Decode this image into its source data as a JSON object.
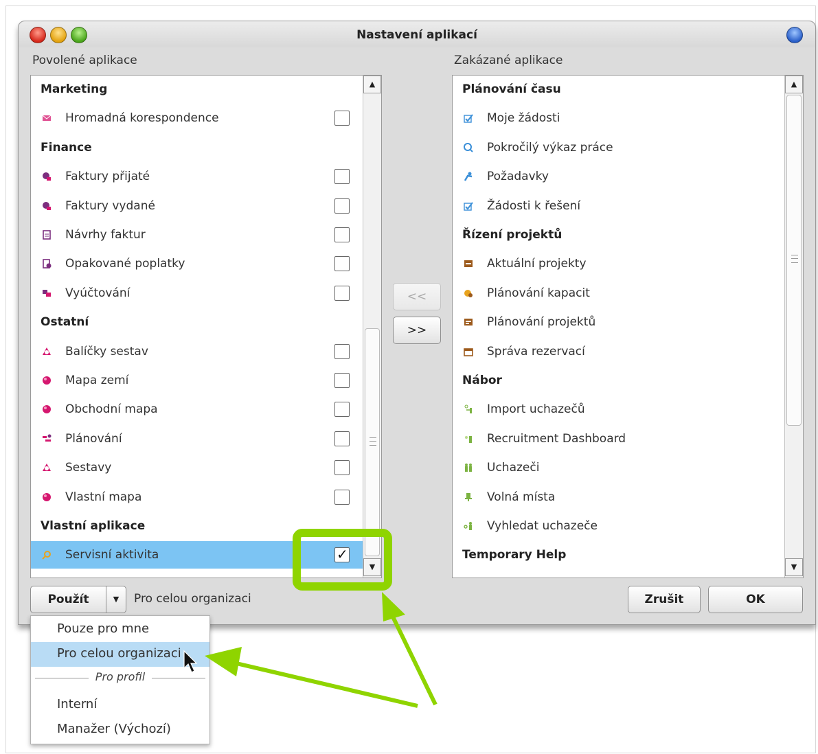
{
  "window": {
    "title": "Nastavení aplikací"
  },
  "enabled_pane": {
    "title": "Povolené aplikace",
    "groups": [
      {
        "name": "Marketing",
        "items": [
          {
            "label": "Hromadná korespondence",
            "icon": "mail-merge-icon",
            "checked": false
          }
        ]
      },
      {
        "name": "Finance",
        "items": [
          {
            "label": "Faktury přijaté",
            "icon": "invoice-received-icon",
            "checked": false
          },
          {
            "label": "Faktury vydané",
            "icon": "invoice-issued-icon",
            "checked": false
          },
          {
            "label": "Návrhy faktur",
            "icon": "document-icon",
            "checked": false
          },
          {
            "label": "Opakované poplatky",
            "icon": "recurring-fee-icon",
            "checked": false
          },
          {
            "label": "Vyúčtování",
            "icon": "billing-icon",
            "checked": false
          }
        ]
      },
      {
        "name": "Ostatní",
        "items": [
          {
            "label": "Balíčky sestav",
            "icon": "report-package-icon",
            "checked": false
          },
          {
            "label": "Mapa zemí",
            "icon": "globe-icon",
            "checked": false
          },
          {
            "label": "Obchodní mapa",
            "icon": "globe-icon",
            "checked": false
          },
          {
            "label": "Plánování",
            "icon": "planning-icon",
            "checked": false
          },
          {
            "label": "Sestavy",
            "icon": "reports-icon",
            "checked": false
          },
          {
            "label": "Vlastní mapa",
            "icon": "globe-icon",
            "checked": false
          }
        ]
      },
      {
        "name": "Vlastní aplikace",
        "items": [
          {
            "label": "Servisní aktivita",
            "icon": "magnifier-icon",
            "checked": true,
            "selected": true
          }
        ]
      }
    ]
  },
  "disabled_pane": {
    "title": "Zakázané aplikace",
    "groups": [
      {
        "name": "Plánování času",
        "items": [
          {
            "label": "Moje žádosti",
            "icon": "checkbox-icon"
          },
          {
            "label": "Pokročilý výkaz práce",
            "icon": "clock-search-icon"
          },
          {
            "label": "Požadavky",
            "icon": "person-request-icon"
          },
          {
            "label": "Žádosti k řešení",
            "icon": "checkbox-icon"
          }
        ]
      },
      {
        "name": "Řízení projektů",
        "items": [
          {
            "label": "Aktuální projekty",
            "icon": "project-icon"
          },
          {
            "label": "Plánování kapacit",
            "icon": "capacity-icon"
          },
          {
            "label": "Plánování projektů",
            "icon": "project-plan-icon"
          },
          {
            "label": "Správa rezervací",
            "icon": "calendar-icon"
          }
        ]
      },
      {
        "name": "Nábor",
        "items": [
          {
            "label": "Import uchazečů",
            "icon": "import-people-icon"
          },
          {
            "label": "Recruitment Dashboard",
            "icon": "dashboard-people-icon"
          },
          {
            "label": "Uchazeči",
            "icon": "people-icon"
          },
          {
            "label": "Volná místa",
            "icon": "chair-icon"
          },
          {
            "label": "Vyhledat uchazeče",
            "icon": "search-person-icon"
          }
        ]
      },
      {
        "name": "Temporary Help",
        "items": []
      }
    ]
  },
  "transfer": {
    "to_left": "<<",
    "to_right": ">>"
  },
  "footer": {
    "apply_label": "Použít",
    "scope_label": "Pro celou organizaci",
    "cancel_label": "Zrušit",
    "ok_label": "OK"
  },
  "scope_menu": {
    "options": [
      "Pouze pro mne",
      "Pro celou organizaci"
    ],
    "active": "Pro celou organizaci",
    "separator_label": "Pro profil",
    "profiles": [
      "Interní",
      "Manažer (Výchozí)"
    ]
  },
  "colors": {
    "selection": "#7cc4f3",
    "menu_highlight": "#b9dcf5",
    "annotation": "#8fd400"
  }
}
